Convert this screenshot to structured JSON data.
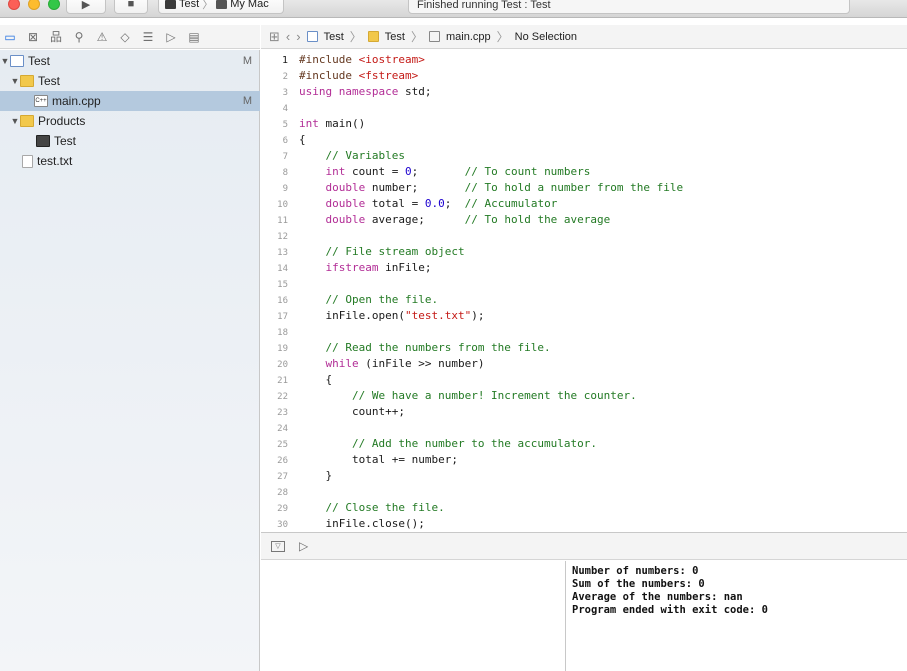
{
  "titlebar": {
    "scheme_target": "Test",
    "scheme_device": "My Mac",
    "status": "Finished running Test : Test"
  },
  "navigator_toolbar": {
    "icons": [
      "folder-icon",
      "source-control-icon",
      "symbol-icon",
      "find-icon",
      "issue-icon",
      "test-icon",
      "debug-icon",
      "breakpoint-icon",
      "report-icon"
    ]
  },
  "navigator": {
    "items": [
      {
        "label": "Test",
        "kind": "project",
        "badge": "M"
      },
      {
        "label": "Test",
        "kind": "folder",
        "badge": ""
      },
      {
        "label": "main.cpp",
        "kind": "cpp",
        "badge": "M"
      },
      {
        "label": "Products",
        "kind": "folder",
        "badge": ""
      },
      {
        "label": "Test",
        "kind": "app",
        "badge": ""
      },
      {
        "label": "test.txt",
        "kind": "txt",
        "badge": ""
      }
    ]
  },
  "jumpbar": {
    "crumbs": [
      "Test",
      "Test",
      "main.cpp",
      "No Selection"
    ]
  },
  "editor": {
    "lines": [
      {
        "n": "1",
        "t": "#include <iostream>"
      },
      {
        "n": "2",
        "t": "#include <fstream>"
      },
      {
        "n": "3",
        "t": "using namespace std;"
      },
      {
        "n": "4",
        "t": ""
      },
      {
        "n": "5",
        "t": "int main()"
      },
      {
        "n": "6",
        "t": "{"
      },
      {
        "n": "7",
        "t": "    // Variables"
      },
      {
        "n": "8",
        "t": "    int count = 0;       // To count numbers"
      },
      {
        "n": "9",
        "t": "    double number;       // To hold a number from the file"
      },
      {
        "n": "10",
        "t": "    double total = 0.0;  // Accumulator"
      },
      {
        "n": "11",
        "t": "    double average;      // To hold the average"
      },
      {
        "n": "12",
        "t": ""
      },
      {
        "n": "13",
        "t": "    // File stream object"
      },
      {
        "n": "14",
        "t": "    ifstream inFile;"
      },
      {
        "n": "15",
        "t": ""
      },
      {
        "n": "16",
        "t": "    // Open the file."
      },
      {
        "n": "17",
        "t": "    inFile.open(\"test.txt\");"
      },
      {
        "n": "18",
        "t": ""
      },
      {
        "n": "19",
        "t": "    // Read the numbers from the file."
      },
      {
        "n": "20",
        "t": "    while (inFile >> number)"
      },
      {
        "n": "21",
        "t": "    {"
      },
      {
        "n": "22",
        "t": "        // We have a number! Increment the counter."
      },
      {
        "n": "23",
        "t": "        count++;"
      },
      {
        "n": "24",
        "t": ""
      },
      {
        "n": "25",
        "t": "        // Add the number to the accumulator."
      },
      {
        "n": "26",
        "t": "        total += number;"
      },
      {
        "n": "27",
        "t": "    }"
      },
      {
        "n": "28",
        "t": ""
      },
      {
        "n": "29",
        "t": "    // Close the file."
      },
      {
        "n": "30",
        "t": "    inFile.close();"
      }
    ]
  },
  "console": {
    "lines": [
      "Number of numbers: 0",
      "Sum of the numbers: 0",
      "Average of the numbers: nan",
      "Program ended with exit code: 0"
    ]
  }
}
